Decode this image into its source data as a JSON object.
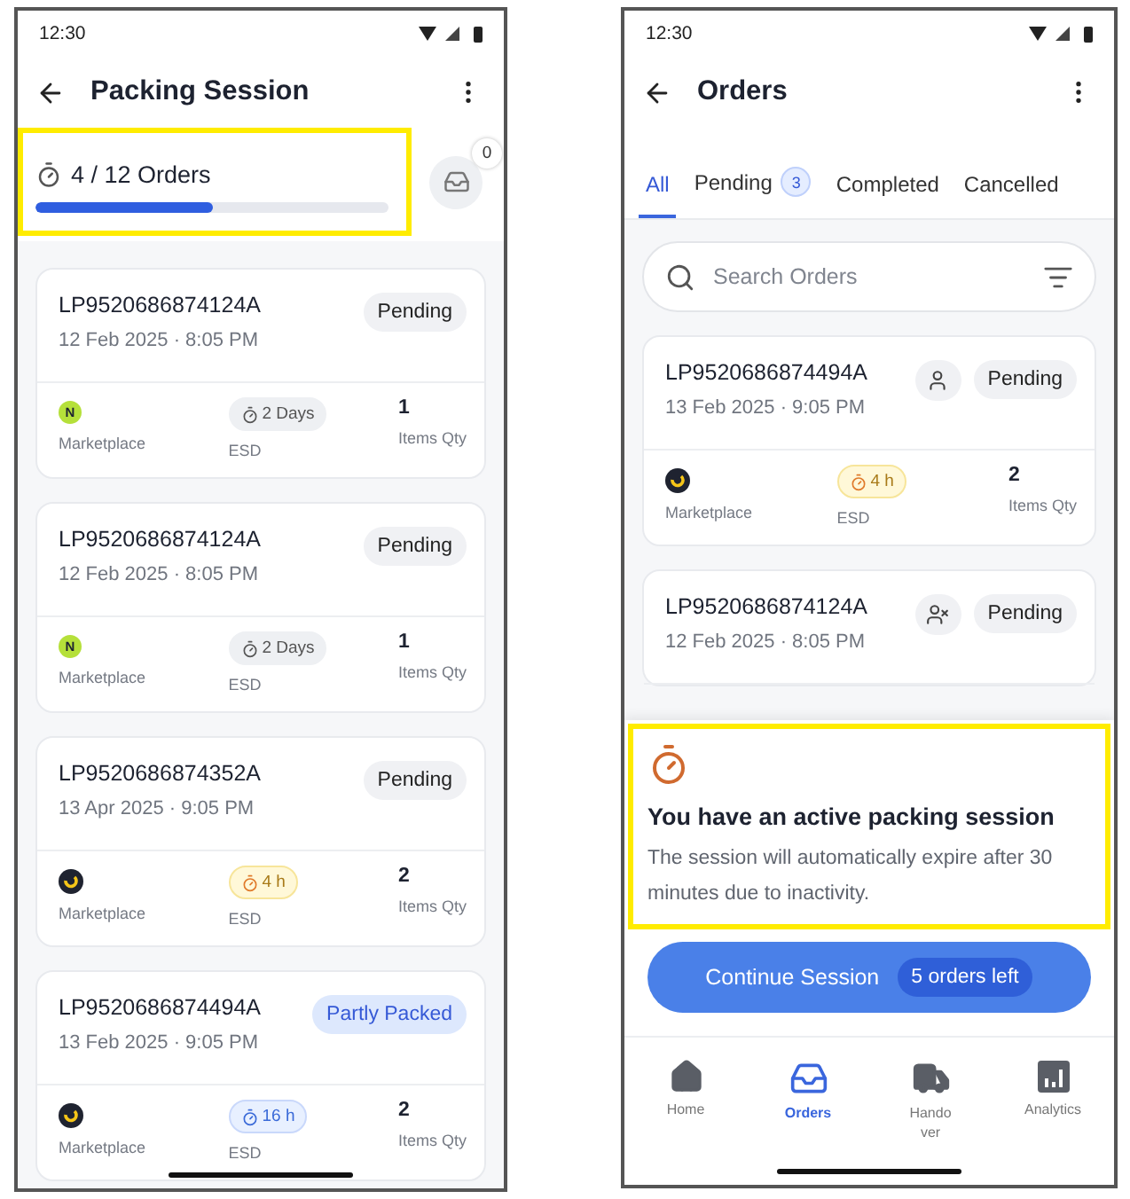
{
  "left": {
    "status_time": "12:30",
    "title": "Packing Session",
    "progress": {
      "label": "4 / 12 Orders",
      "level": 0.5,
      "badge_count": "0"
    },
    "orders": [
      {
        "id": "LP9520686874124A",
        "date": "12 Feb 2025 · 8:05 PM",
        "status": {
          "label": "Pending",
          "kind": "pending"
        },
        "marketplace": {
          "kind": "letter",
          "text": "N",
          "label": "Marketplace"
        },
        "esd": {
          "value": "2 Days",
          "kind": "neutral",
          "label": "ESD"
        },
        "qty": {
          "value": "1",
          "label": "Items Qty"
        }
      },
      {
        "id": "LP9520686874124A",
        "date": "12 Feb 2025 · 8:05 PM",
        "status": {
          "label": "Pending",
          "kind": "pending"
        },
        "marketplace": {
          "kind": "letter",
          "text": "N",
          "label": "Marketplace"
        },
        "esd": {
          "value": "2 Days",
          "kind": "neutral",
          "label": "ESD"
        },
        "qty": {
          "value": "1",
          "label": "Items Qty"
        }
      },
      {
        "id": "LP9520686874352A",
        "date": "13 Apr 2025 · 9:05 PM",
        "status": {
          "label": "Pending",
          "kind": "pending"
        },
        "marketplace": {
          "kind": "ring",
          "label": "Marketplace"
        },
        "esd": {
          "value": "4 h",
          "kind": "warning",
          "label": "ESD"
        },
        "qty": {
          "value": "2",
          "label": "Items Qty"
        }
      },
      {
        "id": "LP9520686874494A",
        "date": "13 Feb 2025 · 9:05 PM",
        "status": {
          "label": "Partly Packed",
          "kind": "partly_packed"
        },
        "marketplace": {
          "kind": "ring",
          "label": "Marketplace"
        },
        "esd": {
          "value": "16 h",
          "kind": "info",
          "label": "ESD"
        },
        "qty": {
          "value": "2",
          "label": "Items Qty"
        }
      }
    ]
  },
  "right": {
    "status_time": "12:30",
    "title": "Orders",
    "tabs": [
      {
        "label": "All",
        "selected": true
      },
      {
        "label": "Pending",
        "count": "3",
        "selected": false
      },
      {
        "label": "Completed",
        "selected": false
      },
      {
        "label": "Cancelled",
        "selected": false
      }
    ],
    "search": {
      "placeholder": "Search Orders"
    },
    "orders": [
      {
        "id": "LP9520686874494A",
        "date": "13 Feb 2025 · 9:05 PM",
        "assigned": true,
        "status": {
          "label": "Pending",
          "kind": "pending"
        },
        "marketplace": {
          "kind": "ring",
          "label": "Marketplace"
        },
        "esd": {
          "value": "4 h",
          "kind": "warning",
          "label": "ESD"
        },
        "qty": {
          "value": "2",
          "label": "Items Qty"
        }
      },
      {
        "id": "LP9520686874124A",
        "date": "12 Feb 2025 · 8:05 PM",
        "assigned": false,
        "status": {
          "label": "Pending",
          "kind": "pending"
        }
      }
    ],
    "session_sheet": {
      "title": "You have an active packing session",
      "text": "The session will automatically expire after 30 minutes due to inactivity.",
      "button": "Continue Session",
      "orders_left": "5 orders left"
    },
    "nav": [
      {
        "label": "Home",
        "kind": "home",
        "selected": false
      },
      {
        "label": "Orders",
        "kind": "orders",
        "selected": true
      },
      {
        "label": "Handover",
        "kind": "handover",
        "selected": false
      },
      {
        "label": "Analytics",
        "kind": "analytics",
        "selected": false
      }
    ]
  }
}
